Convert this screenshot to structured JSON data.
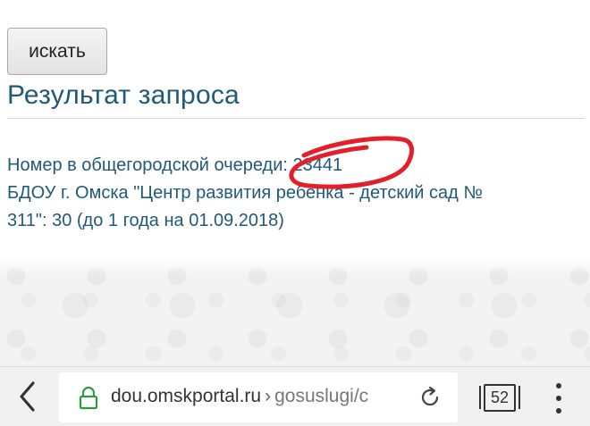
{
  "form": {
    "search_button_label": "искать"
  },
  "result": {
    "title": "Результат запроса",
    "line1": "Номер в общегородской очереди: 23441",
    "line2": "БДОУ г. Омска \"Центр развития ребенка - детский сад №",
    "line3": "311\": 30 (до 1 года на 01.09.2018)"
  },
  "browser": {
    "url_host": "dou.omskportal.ru",
    "url_separator": "›",
    "url_path": "gosuslugi/c",
    "tab_count": "52",
    "icons": {
      "back": "chevron-left-icon",
      "lock": "lock-icon",
      "reload": "reload-icon",
      "tabs": "tabs-icon",
      "menu": "more-vert-icon"
    }
  },
  "colors": {
    "link_text": "#1f5a78",
    "annotation": "#e3202a",
    "toolbar_bg": "#f1f1f1"
  }
}
